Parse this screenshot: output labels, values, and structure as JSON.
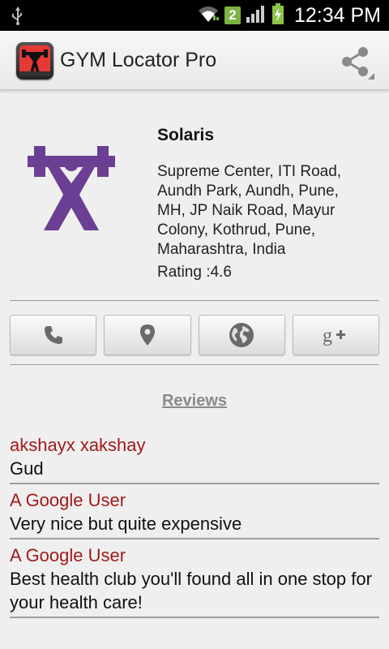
{
  "status_bar": {
    "notification_count": "2",
    "time": "12:34 PM"
  },
  "action_bar": {
    "title": "GYM Locator Pro"
  },
  "gym": {
    "name": "Solaris",
    "address": "Supreme Center, ITI Road, Aundh Park, Aundh, Pune, MH, JP Naik Road, Mayur Colony, Kothrud, Pune, Maharashtra, India",
    "rating_text": "Rating :4.6"
  },
  "actions": [
    {
      "icon": "phone-icon"
    },
    {
      "icon": "location-pin-icon"
    },
    {
      "icon": "globe-icon"
    },
    {
      "icon": "google-plus-icon"
    }
  ],
  "reviews_heading": "Reviews",
  "reviews": [
    {
      "author": "akshayx xakshay",
      "text": "Gud"
    },
    {
      "author": "A Google User",
      "text": "Very nice but quite expensive"
    },
    {
      "author": "A Google User",
      "text": "Best health club you'll found all in one stop for your health care!"
    }
  ],
  "colors": {
    "accent_author": "#a11a1a",
    "gym_icon": "#6b3f93",
    "background": "#efefef"
  }
}
